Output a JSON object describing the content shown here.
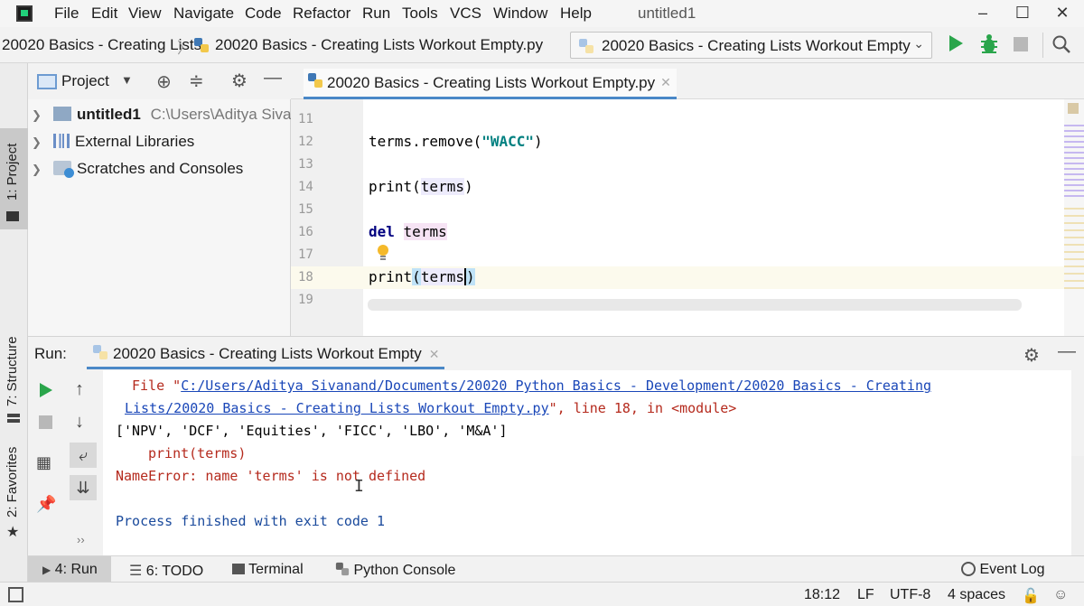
{
  "menubar": {
    "items": [
      "File",
      "Edit",
      "View",
      "Navigate",
      "Code",
      "Refactor",
      "Run",
      "Tools",
      "VCS",
      "Window",
      "Help"
    ],
    "window_title": "untitled1"
  },
  "navbar": {
    "breadcrumb_project": "20020 Basics - Creating Lists",
    "breadcrumb_file": "20020 Basics - Creating Lists Workout Empty.py",
    "run_config": "20020 Basics - Creating Lists Workout Empty"
  },
  "left_strip": {
    "project_tab": "1: Project",
    "structure_tab": "7: Structure",
    "favorites_tab": "2: Favorites"
  },
  "project_panel": {
    "title": "Project",
    "tree": [
      {
        "label": "untitled1",
        "path": "C:\\Users\\Aditya Sivan"
      },
      {
        "label": "External Libraries"
      },
      {
        "label": "Scratches and Consoles"
      }
    ]
  },
  "editor": {
    "tab_label": "20020 Basics - Creating Lists Workout Empty.py",
    "line_numbers": [
      "11",
      "12",
      "13",
      "14",
      "15",
      "16",
      "17",
      "18",
      "19"
    ],
    "code": {
      "l12_pre": "terms.remove(",
      "l12_str": "\"WACC\"",
      "l12_post": ")",
      "l14_fn": "print(",
      "l14_var": "terms",
      "l14_post": ")",
      "l16_kw": "del",
      "l16_var": "terms",
      "l18_fn": "print",
      "l18_paren": "(",
      "l18_var": "terms",
      "l18_post": ")"
    }
  },
  "run_panel": {
    "label": "Run:",
    "tab_label": "20020 Basics - Creating Lists Workout Empty",
    "console": {
      "file_pre": "File \"",
      "file_link_1": "C:/Users/Aditya Sivanand/Documents/20020 Python Basics - Development/20020 Basics - Creating",
      "file_link_2": "Lists/20020 Basics - Creating Lists Workout Empty.py",
      "file_post": "\", line 18, in <module>",
      "output": "['NPV', 'DCF', 'Equities', 'FICC', 'LBO', 'M&A']",
      "trace_code": "print(terms)",
      "error": "NameError: name 'terms' is not defined",
      "finished": "Process finished with exit code 1"
    }
  },
  "bottom_tabs": {
    "run": "4: Run",
    "todo": "6: TODO",
    "terminal": "Terminal",
    "python_console": "Python Console",
    "event_log": "Event Log"
  },
  "status_bar": {
    "position": "18:12",
    "line_sep": "LF",
    "encoding": "UTF-8",
    "indent": "4 spaces"
  }
}
